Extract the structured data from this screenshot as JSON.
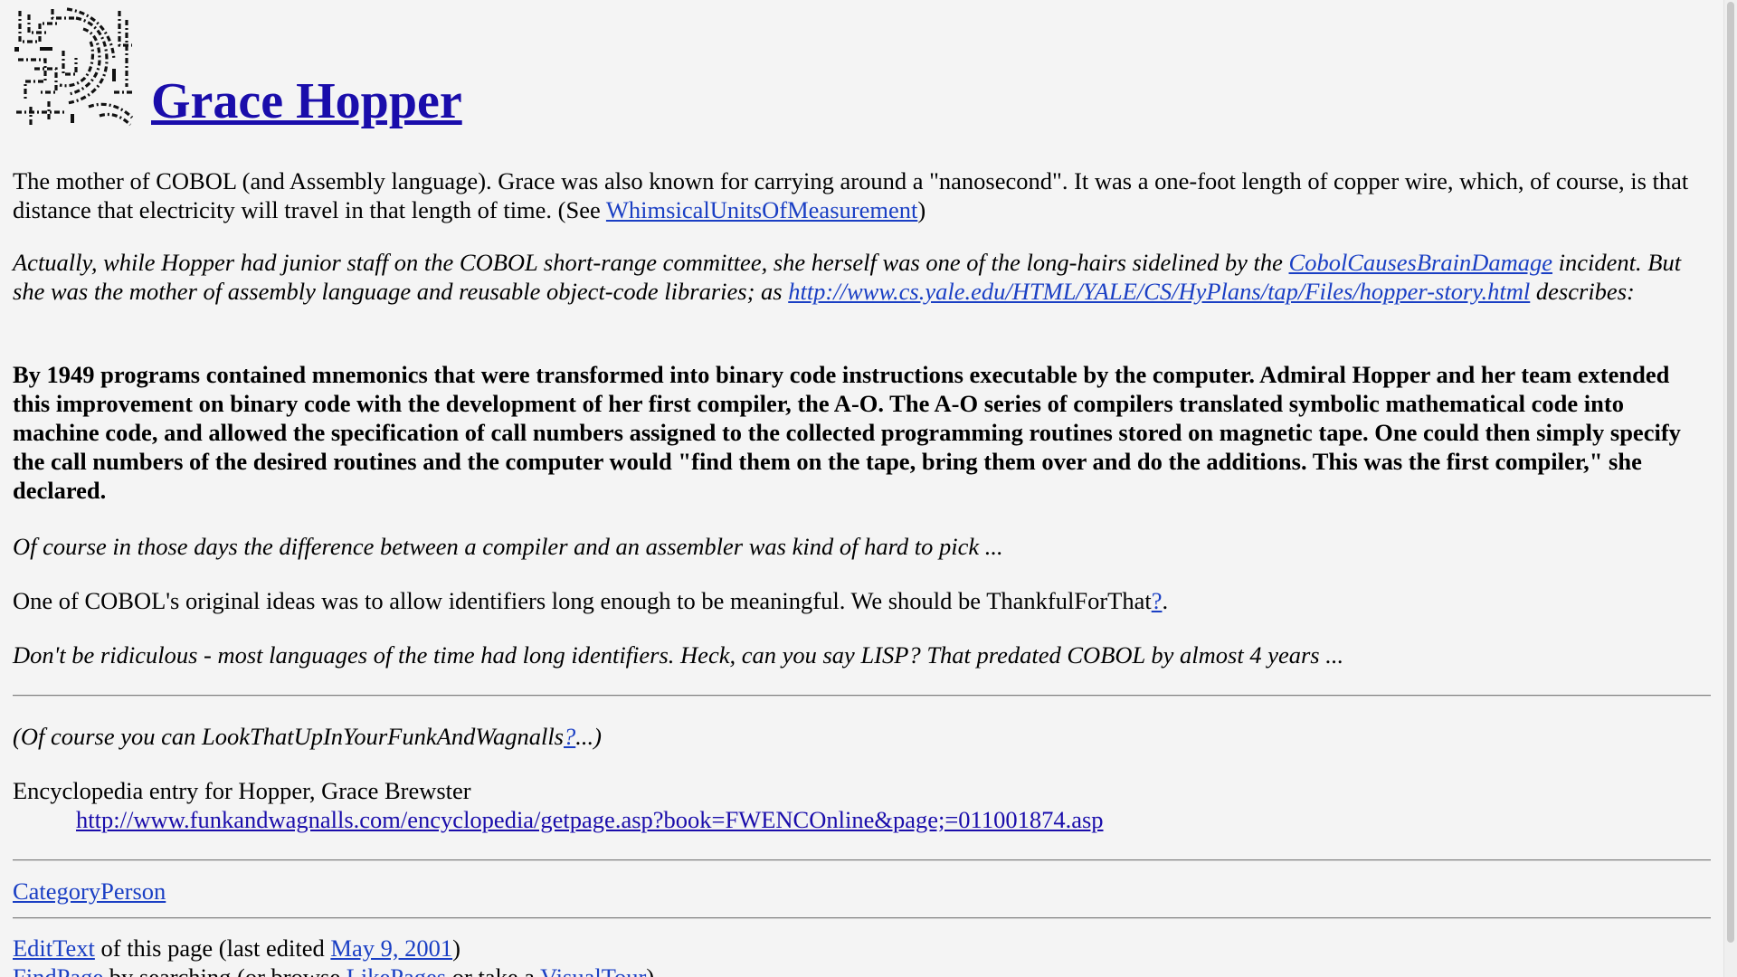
{
  "page": {
    "title": "Grace Hopper",
    "logo": "wiki-logo-icon"
  },
  "p1": {
    "text": "The mother of COBOL (and Assembly language). Grace was also known for carrying around a \"nanosecond\". It was a one-foot length of copper wire, which, of course, is that distance that electricity will travel in that length of time. (See ",
    "link": "WhimsicalUnitsOfMeasurement",
    "tail": ")"
  },
  "p2": {
    "text": "Actually, while Hopper had junior staff on the COBOL short-range committee, she herself was one of the long-hairs sidelined by the ",
    "link1": "CobolCausesBrainDamage",
    "mid": " incident. But she was the mother of assembly language and reusable object-code libraries; as ",
    "link2": "http://www.cs.yale.edu/HTML/YALE/CS/HyPlans/tap/Files/hopper-story.html",
    "tail": " describes:"
  },
  "p3": {
    "text": "By 1949 programs contained mnemonics that were transformed into binary code instructions executable by the computer. Admiral Hopper and her team extended this improvement on binary code with the development of her first compiler, the A-O. The A-O series of compilers translated symbolic mathematical code into machine code, and allowed the specification of call numbers assigned to the collected programming routines stored on magnetic tape. One could then simply specify the call numbers of the desired routines and the computer would \"find them on the tape, bring them over and do the additions. This was the first compiler,\" she declared."
  },
  "p4": {
    "text": "Of course in those days the difference between a compiler and an assembler was kind of hard to pick ..."
  },
  "p5": {
    "text": "One of COBOL's original ideas was to allow identifiers long enough to be meaningful. We should be ThankfulForThat",
    "link": "?",
    "tail": "."
  },
  "p6": {
    "text": "Don't be ridiculous - most languages of the time had long identifiers. Heck, can you say LISP? That predated COBOL by almost 4 years ..."
  },
  "p7": {
    "text": "(Of course you can LookThatUpInYourFunkAndWagnalls",
    "link": "?",
    "tail": "...)"
  },
  "encyclopedia": {
    "term": "Encyclopedia entry for Hopper, Grace Brewster",
    "link": "http://www.funkandwagnalls.com/encyclopedia/getpage.asp?book=FWENCOnline&page;=011001874.asp"
  },
  "category": {
    "link": "CategoryPerson"
  },
  "footer": {
    "edit_link": "EditText",
    "edit_mid": " of this page (last edited ",
    "date_link": "May 9, 2001",
    "edit_tail": ")",
    "find_link": "FindPage",
    "find_mid": " by searching (or browse ",
    "like_link": "LikePages",
    "like_mid": " or take a ",
    "tour_link": "VisualTour",
    "tour_tail": ")"
  }
}
